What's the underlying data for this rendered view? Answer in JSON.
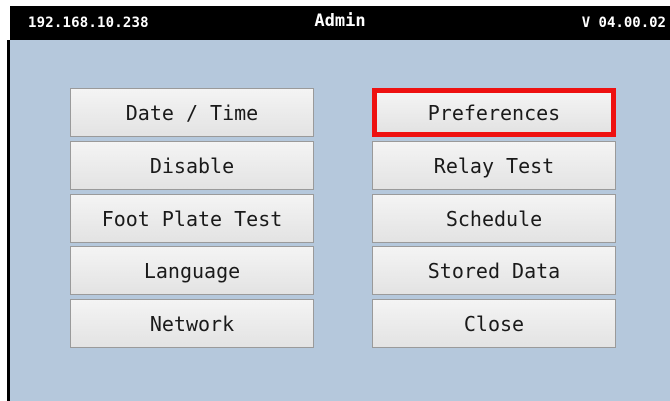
{
  "header": {
    "ip_address": "192.168.10.238",
    "title": "Admin",
    "version": "V 04.00.02"
  },
  "menu": {
    "left": [
      {
        "label": "Date / Time"
      },
      {
        "label": "Disable"
      },
      {
        "label": "Foot Plate Test"
      },
      {
        "label": "Language"
      },
      {
        "label": "Network"
      }
    ],
    "right": [
      {
        "label": "Preferences",
        "selected": true
      },
      {
        "label": "Relay Test"
      },
      {
        "label": "Schedule"
      },
      {
        "label": "Stored Data"
      },
      {
        "label": "Close"
      }
    ]
  },
  "colors": {
    "titlebar_bg": "#000000",
    "panel_bg": "#b5c8dc",
    "selection_border": "#ee1111"
  }
}
